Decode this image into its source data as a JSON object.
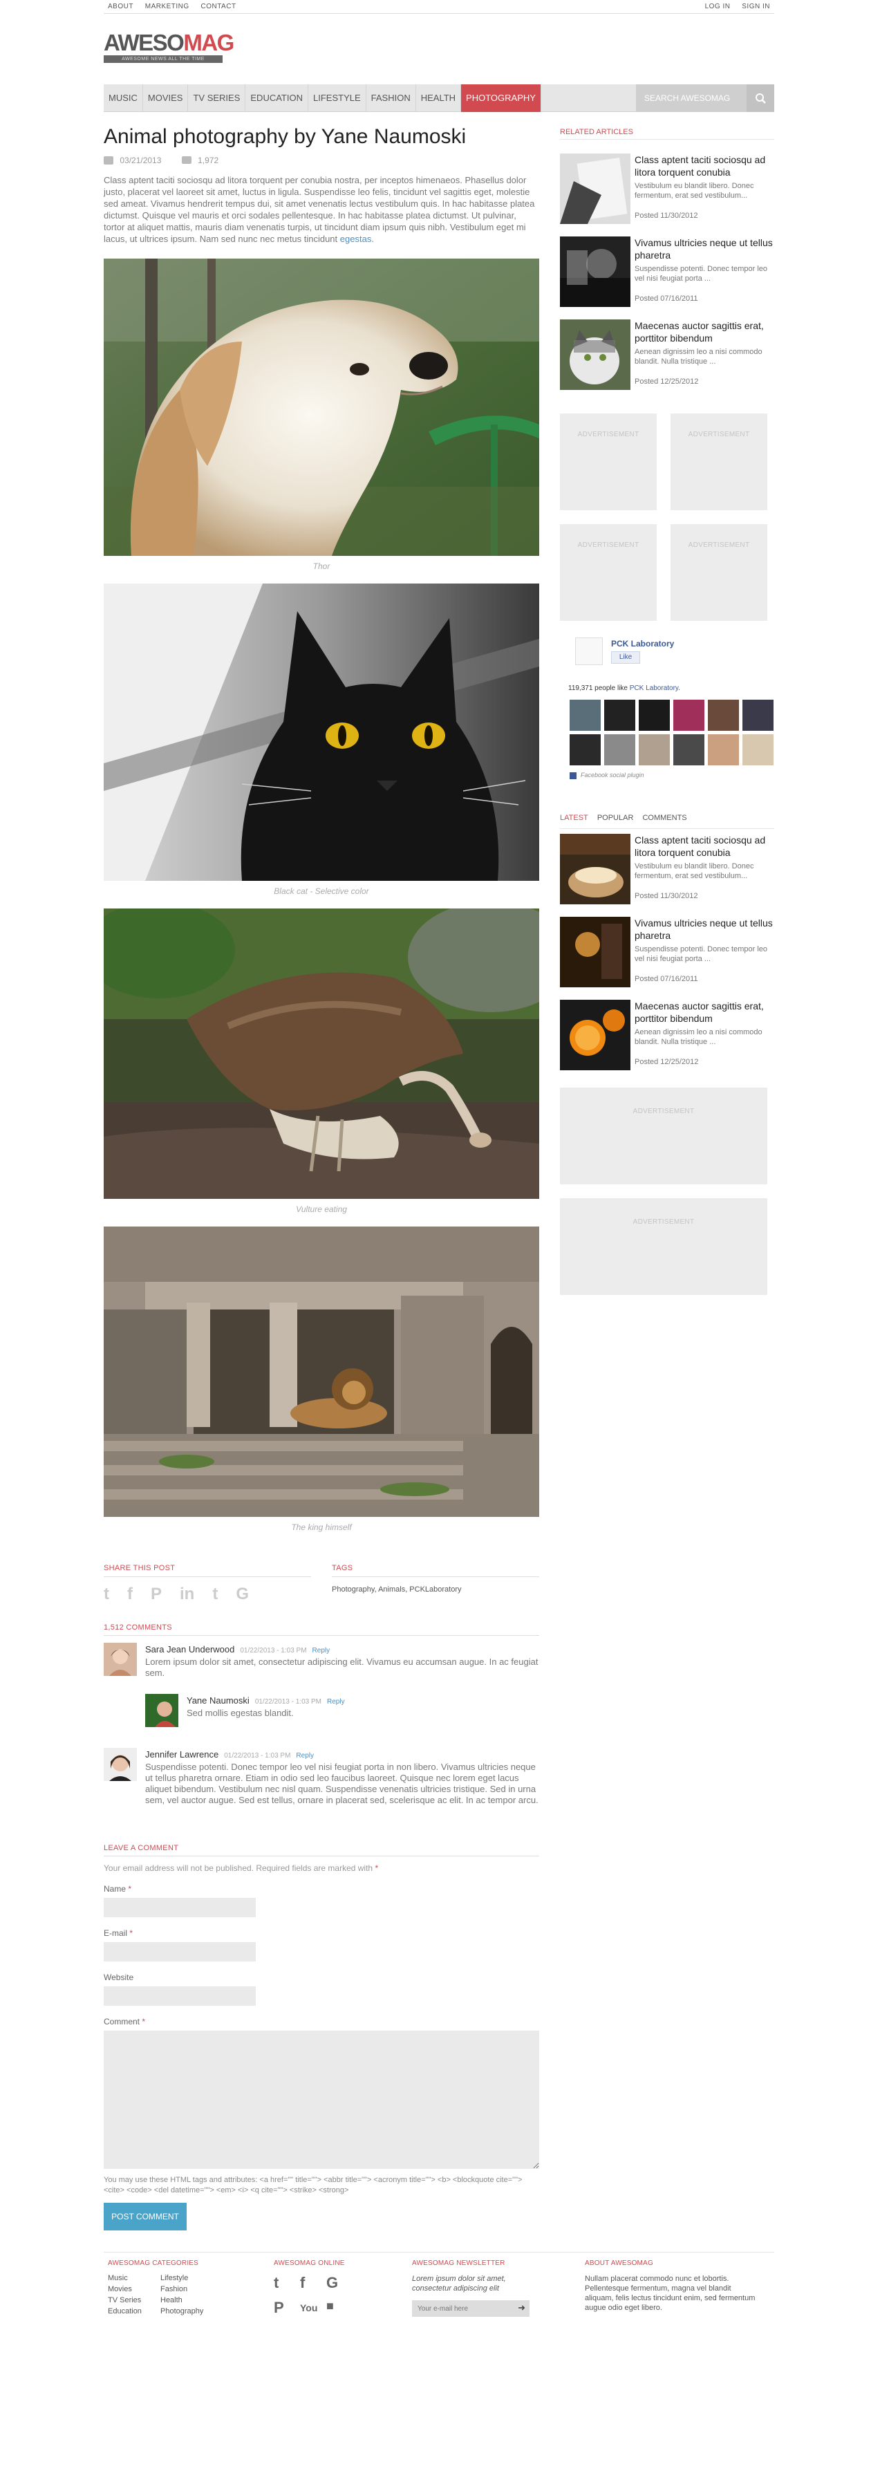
{
  "topbar": {
    "left": [
      "ABOUT",
      "MARKETING",
      "CONTACT"
    ],
    "right": [
      "LOG IN",
      "SIGN IN"
    ]
  },
  "logo": {
    "part1": "AWESO",
    "part2": "MAG",
    "tagline": "AWESOME NEWS ALL THE TIME"
  },
  "nav": {
    "items": [
      "MUSIC",
      "MOVIES",
      "TV SERIES",
      "EDUCATION",
      "LIFESTYLE",
      "FASHION",
      "HEALTH",
      "PHOTOGRAPHY"
    ],
    "active": "PHOTOGRAPHY",
    "search_placeholder": "SEARCH AWESOMAG"
  },
  "article": {
    "title": "Animal photography by Yane Naumoski",
    "date": "03/21/2013",
    "comment_count": "1,972",
    "intro": "Class aptent taciti sociosqu ad litora torquent per conubia nostra, per inceptos himenaeos. Phasellus dolor justo, placerat vel laoreet sit amet, luctus in ligula. Suspendisse leo felis, tincidunt vel sagittis eget, molestie sed ameat. Vivamus hendrerit tempus dui, sit amet venenatis lectus vestibulum quis. In hac habitasse platea dictumst. Quisque vel mauris et orci sodales pellentesque. In hac habitasse platea dictumst. Ut pulvinar, tortor at aliquet mattis, mauris diam venenatis turpis, ut tincidunt diam ipsum quis nibh. Vestibulum eget mi lacus, ut ultrices ipsum. Nam sed nunc nec metus tincidunt",
    "intro_link": "egestas",
    "captions": [
      "Thor",
      "Black cat - Selective color",
      "Vulture eating",
      "The king himself"
    ]
  },
  "share": {
    "heading": "SHARE THIS POST",
    "icons": [
      "twitter-icon",
      "facebook-icon",
      "pinterest-icon",
      "linkedin-icon",
      "tumblr-icon",
      "google-plus-icon"
    ]
  },
  "tags": {
    "heading": "TAGS",
    "text": "Photography, Animals, PCKLaboratory"
  },
  "comments": {
    "heading": "1,512 COMMENTS",
    "reply_label": "Reply",
    "list": [
      {
        "author": "Sara Jean Underwood",
        "date": "01/22/2013 - 1:03 PM",
        "text": "Lorem ipsum dolor sit amet, consectetur adipiscing elit. Vivamus eu accumsan augue. In ac feugiat sem."
      },
      {
        "author": "Yane Naumoski",
        "date": "01/22/2013 - 1:03 PM",
        "text": "Sed mollis egestas blandit."
      },
      {
        "author": "Jennifer Lawrence",
        "date": "01/22/2013 - 1:03 PM",
        "text": "Suspendisse potenti. Donec tempor leo vel nisi feugiat porta in non libero. Vivamus ultricies neque ut tellus pharetra ornare. Etiam in odio sed leo faucibus laoreet. Quisque nec lorem eget lacus aliquet bibendum. Vestibulum nec nisl quam. Suspendisse venenatis ultricies tristique. Sed in urna sem, vel auctor augue. Sed est tellus, ornare in placerat sed, scelerisque ac elit. In ac tempor arcu."
      }
    ]
  },
  "leave_comment": {
    "heading": "LEAVE A COMMENT",
    "note": "Your email address will not be published. Required fields are marked with",
    "req_mark": "*",
    "name_label": "Name",
    "email_label": "E-mail",
    "website_label": "Website",
    "comment_label": "Comment",
    "allowed_tags": "You may use these HTML tags and attributes: <a href=\"\" title=\"\"> <abbr title=\"\"> <acronym title=\"\"> <b> <blockquote cite=\"\"> <cite> <code> <del datetime=\"\"> <em> <i> <q cite=\"\"> <strike> <strong>",
    "submit_label": "POST COMMENT"
  },
  "sidebar": {
    "related_heading": "RELATED ARTICLES",
    "related": [
      {
        "title": "Class aptent taciti sociosqu ad litora torquent conubia",
        "excerpt": "Vestibulum eu blandit libero. Donec fermentum, erat sed vestibulum...",
        "date": "Posted 11/30/2012"
      },
      {
        "title": "Vivamus ultricies neque ut tellus pharetra",
        "excerpt": "Suspendisse potenti. Donec tempor leo vel nisi feugiat porta ...",
        "date": "Posted 07/16/2011"
      },
      {
        "title": "Maecenas auctor sagittis erat, porttitor bibendum",
        "excerpt": "Aenean dignissim leo a nisi commodo blandit. Nulla tristique ...",
        "date": "Posted 12/25/2012"
      }
    ],
    "ad_label": "ADVERTISEMENT",
    "facebook": {
      "page_name": "PCK Laboratory",
      "like_label": "Like",
      "count_text": "119,371 people like",
      "count_link": "PCK Laboratory.",
      "plugin_label": "Facebook social plugin"
    },
    "tabs": [
      "LATEST",
      "POPULAR",
      "COMMENTS"
    ],
    "active_tab": "LATEST",
    "latest": [
      {
        "title": "Class aptent taciti sociosqu ad litora torquent conubia",
        "excerpt": "Vestibulum eu blandit libero. Donec fermentum, erat sed vestibulum...",
        "date": "Posted 11/30/2012"
      },
      {
        "title": "Vivamus ultricies neque ut tellus pharetra",
        "excerpt": "Suspendisse potenti. Donec tempor leo vel nisi feugiat porta ...",
        "date": "Posted 07/16/2011"
      },
      {
        "title": "Maecenas auctor sagittis erat, porttitor bibendum",
        "excerpt": "Aenean dignissim leo a nisi commodo blandit. Nulla tristique ...",
        "date": "Posted 12/25/2012"
      }
    ]
  },
  "footer": {
    "categories_heading": "AWESOMAG CATEGORIES",
    "categories": [
      "Music",
      "Lifestyle",
      "Movies",
      "Fashion",
      "TV Series",
      "Health",
      "Education",
      "Photography"
    ],
    "online_heading": "AWESOMAG ONLINE",
    "online_icons": [
      "twitter-icon",
      "facebook-icon",
      "google-plus-icon",
      "pinterest-icon",
      "youtube-icon",
      "delicious-icon"
    ],
    "newsletter_heading": "AWESOMAG NEWSLETTER",
    "newsletter_text": "Lorem ipsum dolor sit amet, consectetur adipiscing elit",
    "newsletter_placeholder": "Your e-mail here",
    "about_heading": "ABOUT AWESOMAG",
    "about_text": "Nullam placerat commodo nunc et lobortis. Pellentesque fermentum, magna vel blandit aliquam, felis lectus tincidunt enim, sed fermentum augue odio eget libero."
  },
  "colors": {
    "accent": "#d14a50",
    "link": "#4a90c4",
    "button": "#4aa3c8"
  }
}
